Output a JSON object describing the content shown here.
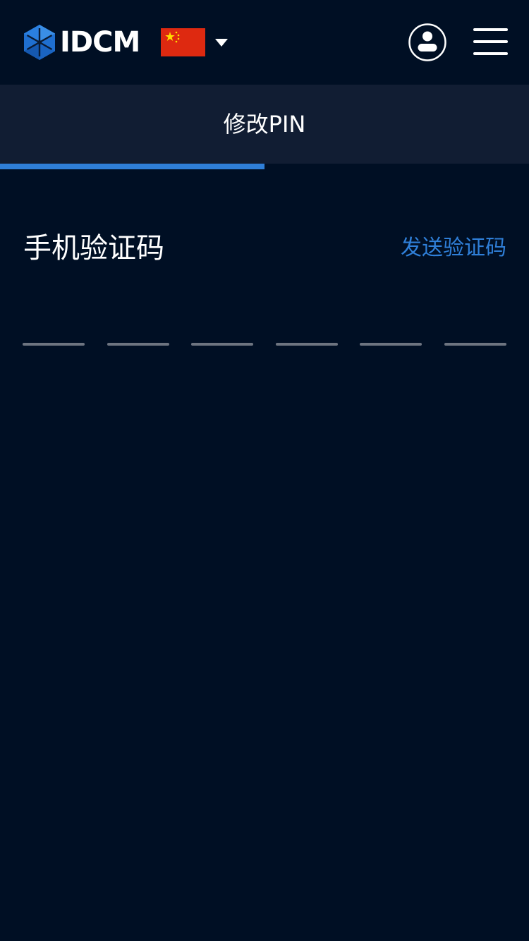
{
  "header": {
    "logo_text": "IDCM",
    "language": {
      "flag_icon": "china-flag-icon",
      "dropdown_icon": "caret-down-icon"
    },
    "user_icon": "user-account-icon",
    "menu_icon": "hamburger-menu-icon"
  },
  "tab": {
    "title": "修改PIN",
    "progress": 0.5
  },
  "verification": {
    "label": "手机验证码",
    "send_button": "发送验证码",
    "code_length": 6
  },
  "colors": {
    "background": "#000f24",
    "tab_bar": "#111d33",
    "accent": "#2f7fd8",
    "slot_line": "#6d7480"
  }
}
